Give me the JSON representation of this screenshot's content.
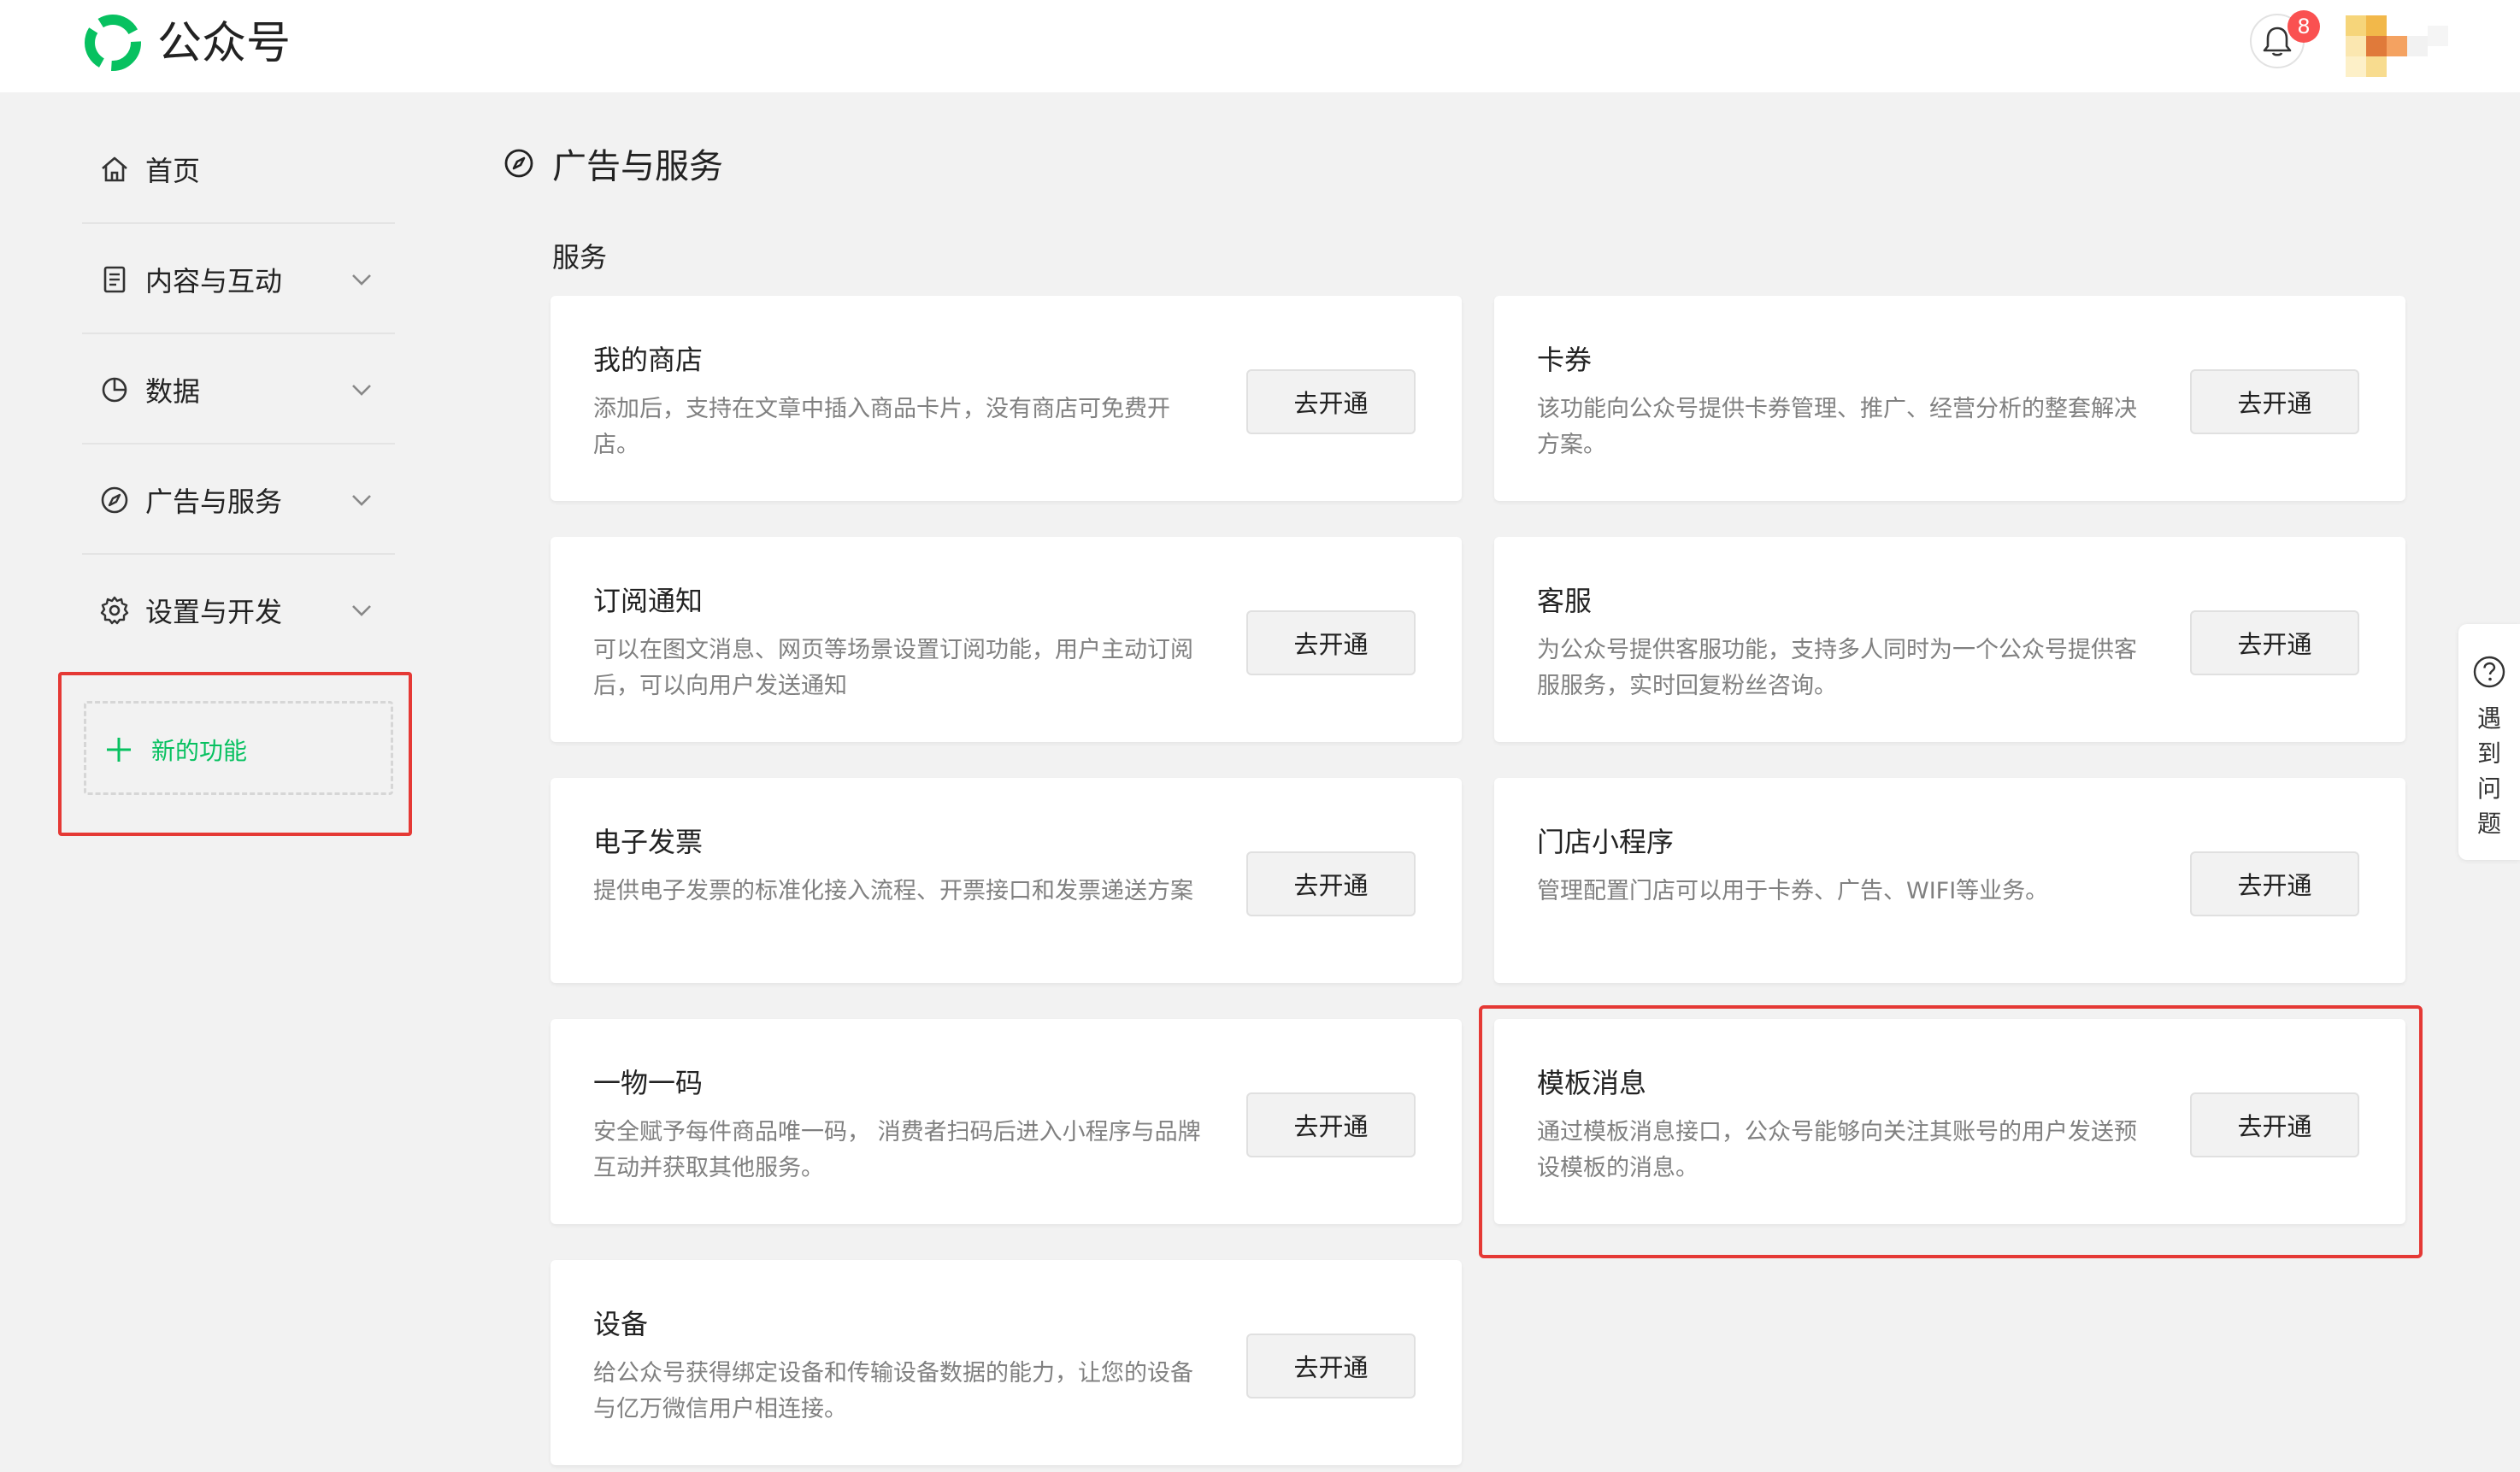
{
  "header": {
    "brand": "公众号",
    "brand_color": "#07c160",
    "notification_count": "8",
    "icons": [
      "logo-icon",
      "bell-icon",
      "avatar"
    ]
  },
  "sidebar": {
    "items": [
      {
        "label": "首页",
        "icon": "home-icon",
        "expandable": false
      },
      {
        "label": "内容与互动",
        "icon": "document-icon",
        "expandable": true
      },
      {
        "label": "数据",
        "icon": "pie-chart-icon",
        "expandable": true
      },
      {
        "label": "广告与服务",
        "icon": "compass-icon",
        "expandable": true
      },
      {
        "label": "设置与开发",
        "icon": "gear-icon",
        "expandable": true
      }
    ],
    "new_feature_label": "新的功能"
  },
  "main": {
    "page_title": "广告与服务",
    "section_title": "服务",
    "button_label": "去开通",
    "cards": [
      {
        "title": "我的商店",
        "desc": "添加后，支持在文章中插入商品卡片，没有商店可免费开店。"
      },
      {
        "title": "卡券",
        "desc": "该功能向公众号提供卡券管理、推广、经营分析的整套解决方案。"
      },
      {
        "title": "订阅通知",
        "desc": "可以在图文消息、网页等场景设置订阅功能，用户主动订阅后，可以向用户发送通知"
      },
      {
        "title": "客服",
        "desc": "为公众号提供客服功能，支持多人同时为一个公众号提供客服服务，实时回复粉丝咨询。"
      },
      {
        "title": "电子发票",
        "desc": "提供电子发票的标准化接入流程、开票接口和发票递送方案"
      },
      {
        "title": "门店小程序",
        "desc": "管理配置门店可以用于卡券、广告、WIFI等业务。"
      },
      {
        "title": "一物一码",
        "desc": "安全赋予每件商品唯一码， 消费者扫码后进入小程序与品牌互动并获取其他服务。"
      },
      {
        "title": "模板消息",
        "desc": "通过模板消息接口，公众号能够向关注其账号的用户发送预设模板的消息。"
      },
      {
        "title": "设备",
        "desc": "给公众号获得绑定设备和传输设备数据的能力，让您的设备与亿万微信用户相连接。"
      }
    ]
  },
  "help": {
    "label": "遇到问题"
  },
  "annotation_color": "#e53935"
}
